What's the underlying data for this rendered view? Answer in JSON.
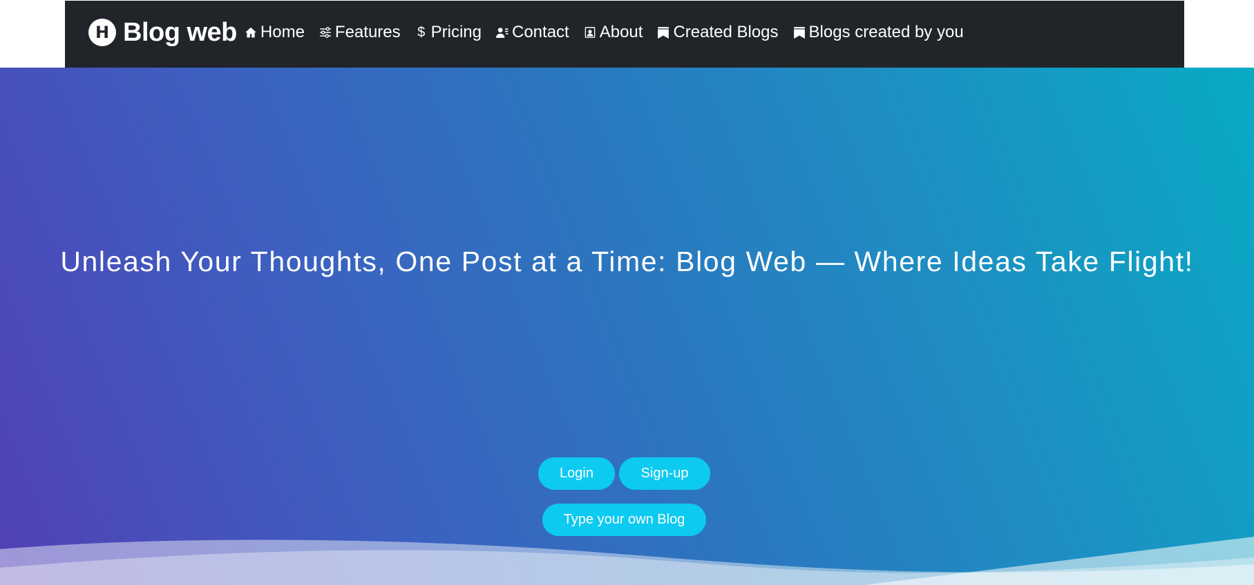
{
  "brand": {
    "name": "Blog web",
    "logo_letter": "H"
  },
  "nav": {
    "items": [
      {
        "label": "Home",
        "icon": "home-icon"
      },
      {
        "label": "Features",
        "icon": "sliders-icon"
      },
      {
        "label": "Pricing",
        "icon": "dollar-icon",
        "glyph": "$"
      },
      {
        "label": "Contact",
        "icon": "person-lines-icon"
      },
      {
        "label": "About",
        "icon": "person-badge-icon"
      },
      {
        "label": "Created Blogs",
        "icon": "bookmarks-icon"
      },
      {
        "label": "Blogs created by you",
        "icon": "bookmarks-icon"
      }
    ]
  },
  "hero": {
    "title": "Unleash Your Thoughts, One Post at a Time: Blog Web — Where Ideas Take Flight!",
    "buttons": {
      "login": "Login",
      "signup": "Sign-up",
      "write": "Type your own Blog"
    }
  },
  "colors": {
    "navbar": "#212529",
    "button": "#0dcaf0",
    "gradient_start": "#5141b6",
    "gradient_end": "#08aac4"
  }
}
